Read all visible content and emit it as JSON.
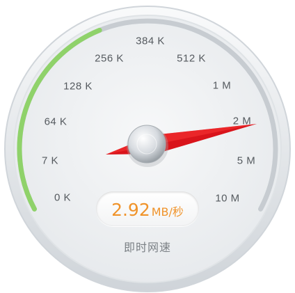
{
  "gauge": {
    "scale_labels": [
      "0 K",
      "7 K",
      "64 K",
      "128 K",
      "256 K",
      "384 K",
      "512 K",
      "1 M",
      "2 M",
      "5 M",
      "10 M"
    ],
    "reading": {
      "value": "2.92",
      "unit": "MB/秒"
    },
    "caption": "即时网速",
    "needle_label": "2 M",
    "colors": {
      "progress_arc": "#8fd26a",
      "needle": "#d9141b",
      "readout_text": "#f0932a",
      "dial_face": "#eef0f2"
    }
  }
}
